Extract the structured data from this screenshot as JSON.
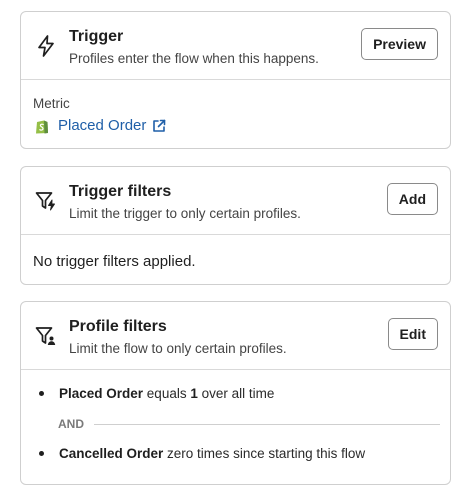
{
  "trigger": {
    "title": "Trigger",
    "subtitle": "Profiles enter the flow when this happens.",
    "button_label": "Preview",
    "metric_label": "Metric",
    "metric_value": "Placed Order"
  },
  "trigger_filters": {
    "title": "Trigger filters",
    "subtitle": "Limit the trigger to only certain profiles.",
    "button_label": "Add",
    "empty_text": "No trigger filters applied."
  },
  "profile_filters": {
    "title": "Profile filters",
    "subtitle": "Limit the flow to only certain profiles.",
    "button_label": "Edit",
    "conditions": [
      {
        "metric": "Placed Order",
        "op": " equals ",
        "count": "1",
        "rest": " over all time"
      },
      {
        "metric": "Cancelled Order",
        "rest": " zero times since starting this flow"
      }
    ],
    "and_label": "AND"
  },
  "colors": {
    "link": "#1f5fa8",
    "shopify_green": "#95bf47",
    "border": "#cfcfcf"
  },
  "icons": [
    "lightning-icon",
    "shopify-icon",
    "external-link-icon",
    "filter-lightning-icon",
    "filter-person-icon"
  ]
}
